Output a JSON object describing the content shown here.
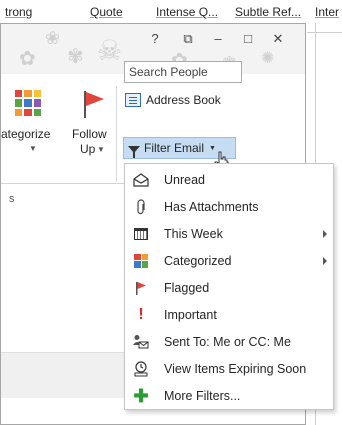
{
  "styles_strip": [
    "trong",
    "Quote",
    "Intense Q...",
    "Subtle Ref...",
    "Inter"
  ],
  "titlebar": {
    "help": "?",
    "restore": "⧉",
    "minimize": "–",
    "maximize": "□",
    "close": "✕"
  },
  "ribbon": {
    "categorize_label": "ategorize",
    "follow_label_line1": "Follow",
    "follow_label_line2": "Up",
    "search_placeholder": "Search People",
    "address_book": "Address Book",
    "filter_email": "Filter Email",
    "group_label": "s"
  },
  "menu": {
    "items": [
      {
        "label": "Unread",
        "icon": "envelope-open-icon",
        "submenu": false
      },
      {
        "label": "Has Attachments",
        "icon": "paperclip-icon",
        "submenu": false
      },
      {
        "label": "This Week",
        "icon": "calendar-icon",
        "submenu": true
      },
      {
        "label": "Categorized",
        "icon": "categories-icon",
        "submenu": true
      },
      {
        "label": "Flagged",
        "icon": "flag-icon",
        "submenu": false
      },
      {
        "label": "Important",
        "icon": "exclamation-icon",
        "submenu": false
      },
      {
        "label": "Sent To: Me or CC: Me",
        "icon": "person-envelope-icon",
        "submenu": false
      },
      {
        "label": "View Items Expiring Soon",
        "icon": "expiring-icon",
        "submenu": false
      },
      {
        "label": "More Filters...",
        "icon": "plus-icon",
        "submenu": false
      }
    ]
  },
  "colors": {
    "highlight": "#c5dcf3",
    "flag": "#e0463c",
    "important": "#d32f2f",
    "more_filters": "#2e9b3a"
  }
}
